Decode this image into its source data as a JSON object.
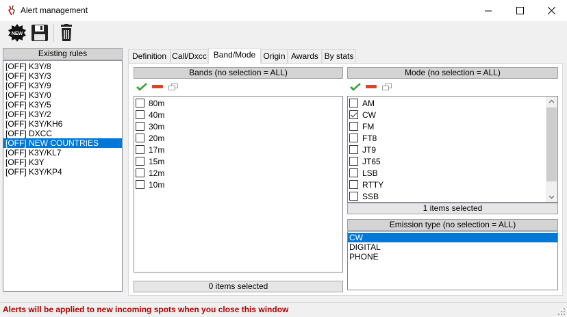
{
  "window": {
    "title": "Alert management",
    "minimize_icon": "minimize-icon",
    "maximize_icon": "maximize-icon",
    "close_icon": "close-icon"
  },
  "toolbar": {
    "new_label": "NEW",
    "buttons": [
      "new-icon",
      "save-icon",
      "trash-icon"
    ]
  },
  "rules": {
    "header": "Existing rules",
    "items": [
      "[OFF] K3Y/8",
      "[OFF] K3Y/3",
      "[OFF] K3Y/9",
      "[OFF] K3Y/0",
      "[OFF] K3Y/5",
      "[OFF] K3Y/2",
      "[OFF] K3Y/KH6",
      "[OFF] DXCC",
      "[OFF] NEW COUNTRIES",
      "[OFF] K3Y/KL7",
      "[OFF] K3Y",
      "[OFF] K3Y/KP4"
    ],
    "selected": "[OFF] NEW COUNTRIES"
  },
  "tabs": [
    "Definition",
    "Call/Dxcc",
    "Band/Mode",
    "Origin",
    "Awards",
    "By stats"
  ],
  "active_tab": "Band/Mode",
  "bands": {
    "header": "Bands (no selection = ALL)",
    "items": [
      "80m",
      "40m",
      "30m",
      "20m",
      "17m",
      "15m",
      "12m",
      "10m"
    ],
    "status": "0 items selected"
  },
  "modes": {
    "header": "Mode (no selection = ALL)",
    "items": [
      "AM",
      "CW",
      "FM",
      "FT8",
      "JT9",
      "JT65",
      "LSB",
      "RTTY",
      "SSB"
    ],
    "checked": [
      "CW"
    ],
    "status": "1 items selected"
  },
  "emission": {
    "header": "Emission type (no selection = ALL)",
    "items": [
      "CW",
      "DIGITAL",
      "PHONE"
    ],
    "selected": "CW"
  },
  "mini_toolbar_icons": [
    "check-all-icon",
    "uncheck-all-icon",
    "copy-icon"
  ],
  "colors": {
    "selection": "#0078d7",
    "status_text": "#b00000"
  },
  "statusbar": {
    "text": "Alerts will be applied to new incoming spots when you close this window"
  }
}
